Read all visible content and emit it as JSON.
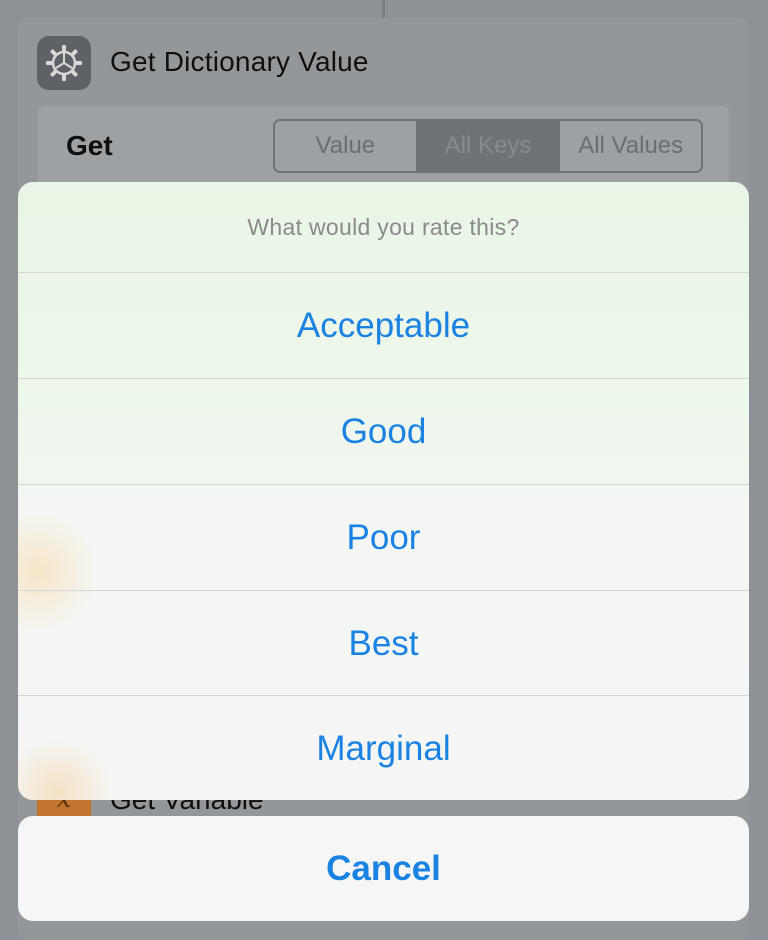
{
  "card": {
    "title": "Get Dictionary Value",
    "icon": "gear-icon",
    "get_label": "Get",
    "segments": [
      "Value",
      "All Keys",
      "All Values"
    ],
    "selected_segment": "All Keys"
  },
  "background_action": {
    "title": "Get Variable",
    "icon": "variable-x-icon",
    "icon_glyph": "x"
  },
  "action_sheet": {
    "message": "What would you rate this?",
    "options": [
      "Acceptable",
      "Good",
      "Poor",
      "Best",
      "Marginal"
    ],
    "cancel_label": "Cancel"
  },
  "colors": {
    "accent": "#1a82e2",
    "dim_background": "#8e9297",
    "variable_icon": "#c1752e"
  }
}
